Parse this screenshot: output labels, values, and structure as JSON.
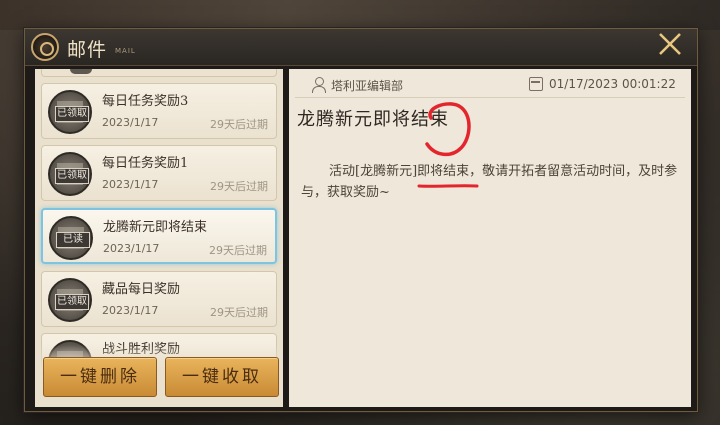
{
  "window": {
    "title": "邮件",
    "subtitle": "MAIL",
    "close_icon": "close-x-icon"
  },
  "mail_list": [
    {
      "stamp": "已领取",
      "title": "每日任务奖励3",
      "date": "2023/1/17",
      "expire": "29天后过期",
      "selected": false
    },
    {
      "stamp": "已领取",
      "title": "每日任务奖励1",
      "date": "2023/1/17",
      "expire": "29天后过期",
      "selected": false
    },
    {
      "stamp": "已读",
      "title": "龙腾新元即将结束",
      "date": "2023/1/17",
      "expire": "29天后过期",
      "selected": true
    },
    {
      "stamp": "已领取",
      "title": "藏品每日奖励",
      "date": "2023/1/17",
      "expire": "29天后过期",
      "selected": false
    },
    {
      "stamp": "",
      "title": "战斗胜利奖励",
      "date": "",
      "expire": "",
      "selected": false
    }
  ],
  "buttons": {
    "delete_all": "一键删除",
    "claim_all": "一键收取"
  },
  "detail": {
    "sender": "塔利亚编辑部",
    "datetime": "01/17/2023 00:01:22",
    "heading": "龙腾新元即将结束",
    "body": "活动[龙腾新元]即将结束，敬请开拓者留意活动时间，及时参与，获取奖励~"
  },
  "colors": {
    "accent_gold": "#c98a35",
    "selected_border": "#7ec3e0",
    "annotation_red": "#e3262d"
  }
}
